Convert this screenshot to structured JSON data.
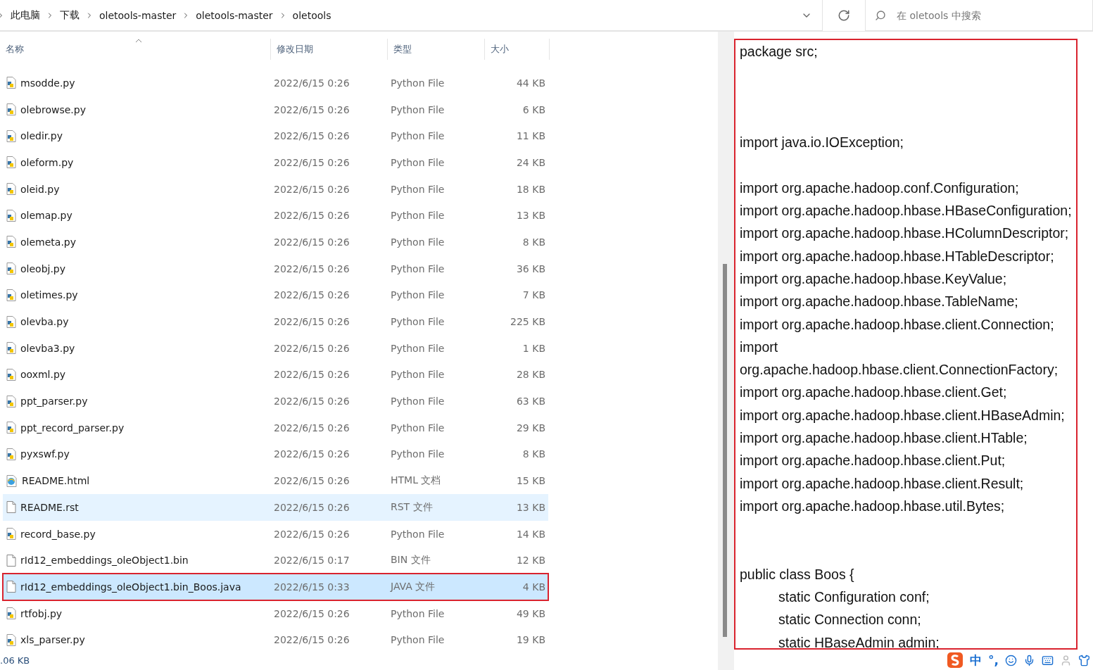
{
  "address_bar": {
    "crumbs": [
      "此电脑",
      "下载",
      "oletools-master",
      "oletools-master",
      "oletools"
    ]
  },
  "search": {
    "placeholder": "在 oletools 中搜索"
  },
  "columns": [
    {
      "label": "名称",
      "sorted": true
    },
    {
      "label": "修改日期",
      "sorted": false
    },
    {
      "label": "类型",
      "sorted": false
    },
    {
      "label": "大小",
      "sorted": false
    }
  ],
  "files": [
    {
      "name": "msodde.py",
      "date": "2022/6/15 0:26",
      "type": "Python File",
      "size": "44 KB",
      "kind": "python",
      "selected": false,
      "hovered": false,
      "outlined": false
    },
    {
      "name": "olebrowse.py",
      "date": "2022/6/15 0:26",
      "type": "Python File",
      "size": "6 KB",
      "kind": "python",
      "selected": false,
      "hovered": false,
      "outlined": false
    },
    {
      "name": "oledir.py",
      "date": "2022/6/15 0:26",
      "type": "Python File",
      "size": "11 KB",
      "kind": "python",
      "selected": false,
      "hovered": false,
      "outlined": false
    },
    {
      "name": "oleform.py",
      "date": "2022/6/15 0:26",
      "type": "Python File",
      "size": "24 KB",
      "kind": "python",
      "selected": false,
      "hovered": false,
      "outlined": false
    },
    {
      "name": "oleid.py",
      "date": "2022/6/15 0:26",
      "type": "Python File",
      "size": "18 KB",
      "kind": "python",
      "selected": false,
      "hovered": false,
      "outlined": false
    },
    {
      "name": "olemap.py",
      "date": "2022/6/15 0:26",
      "type": "Python File",
      "size": "13 KB",
      "kind": "python",
      "selected": false,
      "hovered": false,
      "outlined": false
    },
    {
      "name": "olemeta.py",
      "date": "2022/6/15 0:26",
      "type": "Python File",
      "size": "8 KB",
      "kind": "python",
      "selected": false,
      "hovered": false,
      "outlined": false
    },
    {
      "name": "oleobj.py",
      "date": "2022/6/15 0:26",
      "type": "Python File",
      "size": "36 KB",
      "kind": "python",
      "selected": false,
      "hovered": false,
      "outlined": false
    },
    {
      "name": "oletimes.py",
      "date": "2022/6/15 0:26",
      "type": "Python File",
      "size": "7 KB",
      "kind": "python",
      "selected": false,
      "hovered": false,
      "outlined": false
    },
    {
      "name": "olevba.py",
      "date": "2022/6/15 0:26",
      "type": "Python File",
      "size": "225 KB",
      "kind": "python",
      "selected": false,
      "hovered": false,
      "outlined": false
    },
    {
      "name": "olevba3.py",
      "date": "2022/6/15 0:26",
      "type": "Python File",
      "size": "1 KB",
      "kind": "python",
      "selected": false,
      "hovered": false,
      "outlined": false
    },
    {
      "name": "ooxml.py",
      "date": "2022/6/15 0:26",
      "type": "Python File",
      "size": "28 KB",
      "kind": "python",
      "selected": false,
      "hovered": false,
      "outlined": false
    },
    {
      "name": "ppt_parser.py",
      "date": "2022/6/15 0:26",
      "type": "Python File",
      "size": "63 KB",
      "kind": "python",
      "selected": false,
      "hovered": false,
      "outlined": false
    },
    {
      "name": "ppt_record_parser.py",
      "date": "2022/6/15 0:26",
      "type": "Python File",
      "size": "29 KB",
      "kind": "python",
      "selected": false,
      "hovered": false,
      "outlined": false
    },
    {
      "name": "pyxswf.py",
      "date": "2022/6/15 0:26",
      "type": "Python File",
      "size": "8 KB",
      "kind": "python",
      "selected": false,
      "hovered": false,
      "outlined": false
    },
    {
      "name": "README.html",
      "date": "2022/6/15 0:26",
      "type": "HTML 文档",
      "size": "15 KB",
      "kind": "html",
      "selected": false,
      "hovered": false,
      "outlined": false
    },
    {
      "name": "README.rst",
      "date": "2022/6/15 0:26",
      "type": "RST 文件",
      "size": "13 KB",
      "kind": "file",
      "selected": false,
      "hovered": true,
      "outlined": false
    },
    {
      "name": "record_base.py",
      "date": "2022/6/15 0:26",
      "type": "Python File",
      "size": "14 KB",
      "kind": "python",
      "selected": false,
      "hovered": false,
      "outlined": false
    },
    {
      "name": "rId12_embeddings_oleObject1.bin",
      "date": "2022/6/15 0:17",
      "type": "BIN 文件",
      "size": "12 KB",
      "kind": "file",
      "selected": false,
      "hovered": false,
      "outlined": false
    },
    {
      "name": "rId12_embeddings_oleObject1.bin_Boos.java",
      "date": "2022/6/15 0:33",
      "type": "JAVA 文件",
      "size": "4 KB",
      "kind": "file",
      "selected": true,
      "hovered": false,
      "outlined": true
    },
    {
      "name": "rtfobj.py",
      "date": "2022/6/15 0:26",
      "type": "Python File",
      "size": "49 KB",
      "kind": "python",
      "selected": false,
      "hovered": false,
      "outlined": false
    },
    {
      "name": "xls_parser.py",
      "date": "2022/6/15 0:26",
      "type": "Python File",
      "size": "19 KB",
      "kind": "python",
      "selected": false,
      "hovered": false,
      "outlined": false
    }
  ],
  "status_bar": {
    "size": ".06 KB"
  },
  "code": {
    "lines": [
      {
        "kind": "line",
        "text": "package src;"
      },
      {
        "kind": "blank"
      },
      {
        "kind": "blank"
      },
      {
        "kind": "blank"
      },
      {
        "kind": "line",
        "text": "import java.io.IOException;"
      },
      {
        "kind": "blank"
      },
      {
        "kind": "line",
        "text": "import org.apache.hadoop.conf.Configuration;"
      },
      {
        "kind": "line",
        "text": "import org.apache.hadoop.hbase.HBaseConfiguration;"
      },
      {
        "kind": "line",
        "text": "import org.apache.hadoop.hbase.HColumnDescriptor;"
      },
      {
        "kind": "line",
        "text": "import org.apache.hadoop.hbase.HTableDescriptor;"
      },
      {
        "kind": "line",
        "text": "import org.apache.hadoop.hbase.KeyValue;"
      },
      {
        "kind": "line",
        "text": "import org.apache.hadoop.hbase.TableName;"
      },
      {
        "kind": "line",
        "text": "import org.apache.hadoop.hbase.client.Connection;"
      },
      {
        "kind": "line",
        "text": "import"
      },
      {
        "kind": "line",
        "text": "org.apache.hadoop.hbase.client.ConnectionFactory;"
      },
      {
        "kind": "line",
        "text": "import org.apache.hadoop.hbase.client.Get;"
      },
      {
        "kind": "line",
        "text": "import org.apache.hadoop.hbase.client.HBaseAdmin;"
      },
      {
        "kind": "line",
        "text": "import org.apache.hadoop.hbase.client.HTable;"
      },
      {
        "kind": "line",
        "text": "import org.apache.hadoop.hbase.client.Put;"
      },
      {
        "kind": "line",
        "text": "import org.apache.hadoop.hbase.client.Result;"
      },
      {
        "kind": "line",
        "text": "import org.apache.hadoop.hbase.util.Bytes;"
      },
      {
        "kind": "blank"
      },
      {
        "kind": "blank"
      },
      {
        "kind": "line",
        "text": "public class Boos {"
      },
      {
        "kind": "indented",
        "text": "static  Configuration conf;"
      },
      {
        "kind": "indented",
        "text": "static  Connection  conn;"
      },
      {
        "kind": "indented",
        "text": "static  HBaseAdmin   admin;"
      }
    ]
  },
  "ime_toolbar": {
    "mode": "中",
    "punctuation": "°,"
  }
}
